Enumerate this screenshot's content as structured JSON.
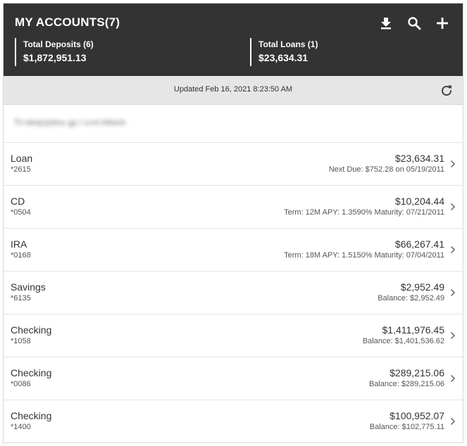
{
  "header": {
    "title": "MY ACCOUNTS(7)",
    "icons": [
      "download-icon",
      "search-icon",
      "plus-icon"
    ],
    "deposits_label": "Total Deposits (6)",
    "deposits_value": "$1,872,951.13",
    "loans_label": "Total Loans (1)",
    "loans_value": "$23,634.31"
  },
  "updated": {
    "text": "Updated Feb 16, 2021 8:23:50 AM",
    "icon": "refresh-icon"
  },
  "blurred_row": {
    "text": "Th bkdytyblox gp l ccnt klkkeh"
  },
  "accounts": [
    {
      "name": "Loan",
      "number": "*2615",
      "amount": "$23,634.31",
      "detail": "Next Due: $752.28 on 05/19/2011"
    },
    {
      "name": "CD",
      "number": "*0504",
      "amount": "$10,204.44",
      "detail": "Term: 12M  APY: 1.3590%  Maturity: 07/21/2011"
    },
    {
      "name": "IRA",
      "number": "*0168",
      "amount": "$66,267.41",
      "detail": "Term: 18M  APY: 1.5150%  Maturity: 07/04/2011"
    },
    {
      "name": "Savings",
      "number": "*6135",
      "amount": "$2,952.49",
      "detail": "Balance: $2,952.49"
    },
    {
      "name": "Checking",
      "number": "*1058",
      "amount": "$1,411,976.45",
      "detail": "Balance: $1,401,536.62"
    },
    {
      "name": "Checking",
      "number": "*0086",
      "amount": "$289,215.06",
      "detail": "Balance: $289,215.06"
    },
    {
      "name": "Checking",
      "number": "*1400",
      "amount": "$100,952.07",
      "detail": "Balance: $102,775.11"
    }
  ],
  "colors": {
    "header_bg": "#333333",
    "updated_bg": "#e6e6e6",
    "text": "#333333"
  }
}
